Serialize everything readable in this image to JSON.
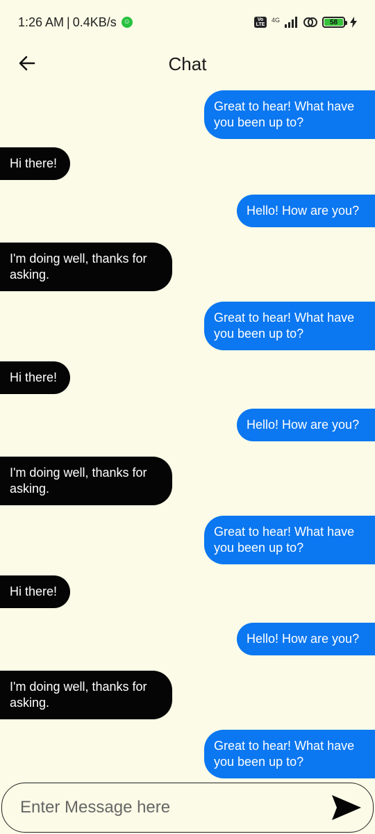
{
  "status_bar": {
    "time": "1:26 AM",
    "separator": "|",
    "speed": "0.4KB/s",
    "volte_top": "Vo",
    "volte_bottom": "LTE",
    "network": "4G",
    "battery": "58"
  },
  "app_bar": {
    "title": "Chat",
    "back_icon": "arrow-left-icon"
  },
  "messages": [
    {
      "type": "sent",
      "text": "Great to hear! What have you been up to?"
    },
    {
      "type": "received",
      "text": "Hi there!"
    },
    {
      "type": "sent",
      "text": "Hello! How are you?"
    },
    {
      "type": "received",
      "text": "I'm doing well, thanks for asking."
    },
    {
      "type": "sent",
      "text": "Great to hear! What have you been up to?"
    },
    {
      "type": "received",
      "text": "Hi there!"
    },
    {
      "type": "sent",
      "text": "Hello! How are you?"
    },
    {
      "type": "received",
      "text": "I'm doing well, thanks for asking."
    },
    {
      "type": "sent",
      "text": "Great to hear! What have you been up to?"
    },
    {
      "type": "received",
      "text": "Hi there!"
    },
    {
      "type": "sent",
      "text": "Hello! How are you?"
    },
    {
      "type": "received",
      "text": "I'm doing well, thanks for asking."
    },
    {
      "type": "sent",
      "text": "Great to hear! What have you been up to?"
    }
  ],
  "input": {
    "placeholder": "Enter Message here",
    "value": "",
    "send_icon": "send-icon"
  },
  "colors": {
    "background": "#fbfbe7",
    "sent_bubble": "#0b77f0",
    "received_bubble": "#050505"
  }
}
